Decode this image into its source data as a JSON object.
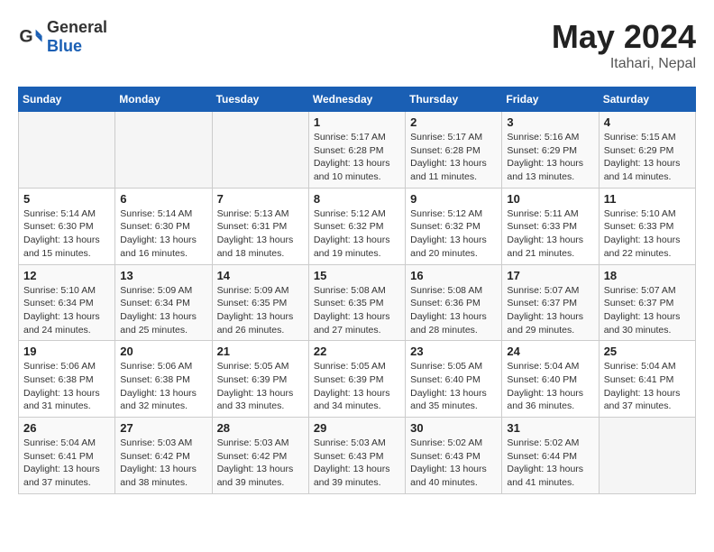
{
  "header": {
    "logo_general": "General",
    "logo_blue": "Blue",
    "title": "May 2024",
    "location": "Itahari, Nepal"
  },
  "weekdays": [
    "Sunday",
    "Monday",
    "Tuesday",
    "Wednesday",
    "Thursday",
    "Friday",
    "Saturday"
  ],
  "weeks": [
    [
      {
        "day": "",
        "info": ""
      },
      {
        "day": "",
        "info": ""
      },
      {
        "day": "",
        "info": ""
      },
      {
        "day": "1",
        "info": "Sunrise: 5:17 AM\nSunset: 6:28 PM\nDaylight: 13 hours and 10 minutes."
      },
      {
        "day": "2",
        "info": "Sunrise: 5:17 AM\nSunset: 6:28 PM\nDaylight: 13 hours and 11 minutes."
      },
      {
        "day": "3",
        "info": "Sunrise: 5:16 AM\nSunset: 6:29 PM\nDaylight: 13 hours and 13 minutes."
      },
      {
        "day": "4",
        "info": "Sunrise: 5:15 AM\nSunset: 6:29 PM\nDaylight: 13 hours and 14 minutes."
      }
    ],
    [
      {
        "day": "5",
        "info": "Sunrise: 5:14 AM\nSunset: 6:30 PM\nDaylight: 13 hours and 15 minutes."
      },
      {
        "day": "6",
        "info": "Sunrise: 5:14 AM\nSunset: 6:30 PM\nDaylight: 13 hours and 16 minutes."
      },
      {
        "day": "7",
        "info": "Sunrise: 5:13 AM\nSunset: 6:31 PM\nDaylight: 13 hours and 18 minutes."
      },
      {
        "day": "8",
        "info": "Sunrise: 5:12 AM\nSunset: 6:32 PM\nDaylight: 13 hours and 19 minutes."
      },
      {
        "day": "9",
        "info": "Sunrise: 5:12 AM\nSunset: 6:32 PM\nDaylight: 13 hours and 20 minutes."
      },
      {
        "day": "10",
        "info": "Sunrise: 5:11 AM\nSunset: 6:33 PM\nDaylight: 13 hours and 21 minutes."
      },
      {
        "day": "11",
        "info": "Sunrise: 5:10 AM\nSunset: 6:33 PM\nDaylight: 13 hours and 22 minutes."
      }
    ],
    [
      {
        "day": "12",
        "info": "Sunrise: 5:10 AM\nSunset: 6:34 PM\nDaylight: 13 hours and 24 minutes."
      },
      {
        "day": "13",
        "info": "Sunrise: 5:09 AM\nSunset: 6:34 PM\nDaylight: 13 hours and 25 minutes."
      },
      {
        "day": "14",
        "info": "Sunrise: 5:09 AM\nSunset: 6:35 PM\nDaylight: 13 hours and 26 minutes."
      },
      {
        "day": "15",
        "info": "Sunrise: 5:08 AM\nSunset: 6:35 PM\nDaylight: 13 hours and 27 minutes."
      },
      {
        "day": "16",
        "info": "Sunrise: 5:08 AM\nSunset: 6:36 PM\nDaylight: 13 hours and 28 minutes."
      },
      {
        "day": "17",
        "info": "Sunrise: 5:07 AM\nSunset: 6:37 PM\nDaylight: 13 hours and 29 minutes."
      },
      {
        "day": "18",
        "info": "Sunrise: 5:07 AM\nSunset: 6:37 PM\nDaylight: 13 hours and 30 minutes."
      }
    ],
    [
      {
        "day": "19",
        "info": "Sunrise: 5:06 AM\nSunset: 6:38 PM\nDaylight: 13 hours and 31 minutes."
      },
      {
        "day": "20",
        "info": "Sunrise: 5:06 AM\nSunset: 6:38 PM\nDaylight: 13 hours and 32 minutes."
      },
      {
        "day": "21",
        "info": "Sunrise: 5:05 AM\nSunset: 6:39 PM\nDaylight: 13 hours and 33 minutes."
      },
      {
        "day": "22",
        "info": "Sunrise: 5:05 AM\nSunset: 6:39 PM\nDaylight: 13 hours and 34 minutes."
      },
      {
        "day": "23",
        "info": "Sunrise: 5:05 AM\nSunset: 6:40 PM\nDaylight: 13 hours and 35 minutes."
      },
      {
        "day": "24",
        "info": "Sunrise: 5:04 AM\nSunset: 6:40 PM\nDaylight: 13 hours and 36 minutes."
      },
      {
        "day": "25",
        "info": "Sunrise: 5:04 AM\nSunset: 6:41 PM\nDaylight: 13 hours and 37 minutes."
      }
    ],
    [
      {
        "day": "26",
        "info": "Sunrise: 5:04 AM\nSunset: 6:41 PM\nDaylight: 13 hours and 37 minutes."
      },
      {
        "day": "27",
        "info": "Sunrise: 5:03 AM\nSunset: 6:42 PM\nDaylight: 13 hours and 38 minutes."
      },
      {
        "day": "28",
        "info": "Sunrise: 5:03 AM\nSunset: 6:42 PM\nDaylight: 13 hours and 39 minutes."
      },
      {
        "day": "29",
        "info": "Sunrise: 5:03 AM\nSunset: 6:43 PM\nDaylight: 13 hours and 39 minutes."
      },
      {
        "day": "30",
        "info": "Sunrise: 5:02 AM\nSunset: 6:43 PM\nDaylight: 13 hours and 40 minutes."
      },
      {
        "day": "31",
        "info": "Sunrise: 5:02 AM\nSunset: 6:44 PM\nDaylight: 13 hours and 41 minutes."
      },
      {
        "day": "",
        "info": ""
      }
    ]
  ]
}
